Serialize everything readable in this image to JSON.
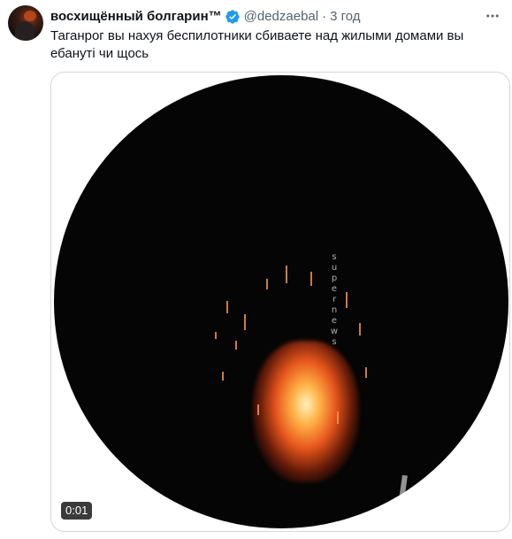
{
  "tweet": {
    "author_name": "восхищённый болгарин™",
    "handle": "@dedzaebal",
    "separator": "·",
    "time": "3 год",
    "text": "Таганрог вы нахуя беспилотники сбиваете над жилыми домами вы ебануті чи щось",
    "verified_icon": "verified-badge-icon",
    "more_icon": "more-options-icon"
  },
  "media": {
    "watermark": "supernews",
    "video_time": "0:01"
  },
  "colors": {
    "verified": "#1d9bf0",
    "secondary_text": "#536471",
    "media_border": "#cfd9de"
  }
}
